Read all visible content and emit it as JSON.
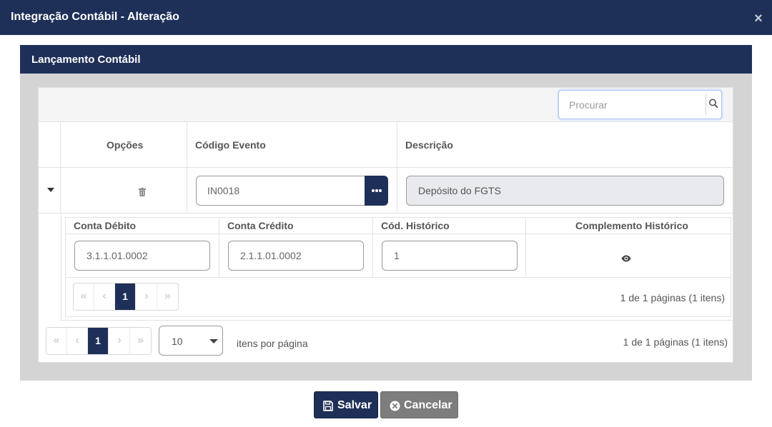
{
  "modal": {
    "title": "Integração Contábil - Alteração",
    "close": "×"
  },
  "panel": {
    "title": "Lançamento Contábil"
  },
  "search": {
    "placeholder": "Procurar",
    "icon": "search-icon"
  },
  "grid": {
    "columns": [
      "Opções",
      "Código Evento",
      "Descrição"
    ],
    "rows": [
      {
        "codigo_evento": "IN0018",
        "descricao": "Depósito do FGTS"
      }
    ]
  },
  "detail": {
    "columns": [
      "Conta Débito",
      "Conta Crédito",
      "Cód. Histórico",
      "Complemento Histórico"
    ],
    "rows": [
      {
        "conta_debito": "3.1.1.01.0002",
        "conta_credito": "2.1.1.01.0002",
        "cod_historico": "1"
      }
    ],
    "pager": {
      "first": "«",
      "prev": "‹",
      "current": "1",
      "next": "›",
      "last": "»",
      "info": "1 de 1 páginas (1 itens)"
    }
  },
  "pager": {
    "first": "«",
    "prev": "‹",
    "current": "1",
    "next": "›",
    "last": "»",
    "page_size": "10",
    "per_page_label": "itens por página",
    "info": "1 de 1 páginas (1 itens)"
  },
  "buttons": {
    "save": "Salvar",
    "cancel": "Cancelar"
  },
  "colors": {
    "primary": "#1f3058",
    "secondary": "#7d7d7d",
    "panel_bg": "#d4d4d4"
  }
}
